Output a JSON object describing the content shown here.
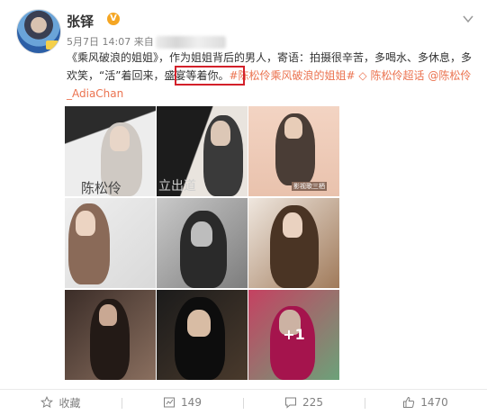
{
  "user": {
    "name": "张铎",
    "verified_badge": "V"
  },
  "post_meta": {
    "date": "5月7日 14:07",
    "source_prefix": "来自"
  },
  "post_text": {
    "part1": "《乘风破浪的姐姐》，作为姐姐背后的男人，寄语：拍摄很辛苦，多喝水、多休息，多欢笑，",
    "highlighted": "“活”着回来，",
    "part2": "盛宴等着你。",
    "hashtag": "#陈松伶乘风破浪的姐姐#",
    "super_topic": "陈松伶超话",
    "mention": "@陈松伶_AdiaChan"
  },
  "images": [
    {
      "overlay": "陈松伶"
    },
    {
      "overlay": "立出道"
    },
    {
      "overlay": "影视歌三栖"
    },
    {
      "overlay": ""
    },
    {
      "overlay": ""
    },
    {
      "overlay": ""
    },
    {
      "overlay": ""
    },
    {
      "overlay": ""
    },
    {
      "overlay": "+1"
    }
  ],
  "actions": {
    "favorite": "收藏",
    "repost": "149",
    "comment": "225",
    "like": "1470"
  },
  "icons": {
    "more": "chevron-down-icon",
    "favorite": "star-icon",
    "repost": "repost-icon",
    "comment": "comment-icon",
    "like": "thumb-up-icon",
    "super_topic": "diamond-icon"
  },
  "colors": {
    "link": "#eb7350",
    "highlight_box": "#d3202a",
    "verified": "#f5a623"
  }
}
